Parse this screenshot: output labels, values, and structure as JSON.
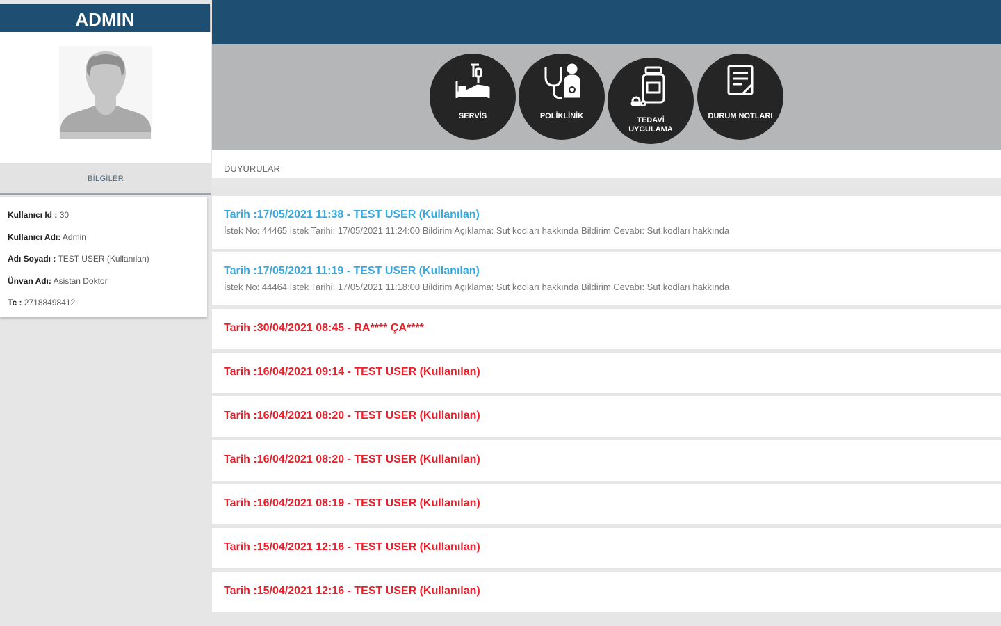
{
  "sidebar": {
    "header_title": "ADMIN",
    "bilgiler_label": "BİLGİLER",
    "info": [
      {
        "label": "Kullanıcı Id :",
        "value": "30"
      },
      {
        "label": "Kullanıcı Adı:",
        "value": "Admin"
      },
      {
        "label": "Adı Soyadı :",
        "value": "TEST USER (Kullanılan)"
      },
      {
        "label": "Ünvan Adı:",
        "value": "Asistan Doktor"
      },
      {
        "label": "Tc :",
        "value": "27188498412"
      }
    ]
  },
  "menu": {
    "buttons": [
      {
        "label": "SERVİS",
        "icon": "hospital-bed-iv-icon"
      },
      {
        "label": "POLİKLİNİK",
        "icon": "stethoscope-doctor-icon"
      },
      {
        "label_line1": "TEDAVİ",
        "label_line2": "UYGULAMA",
        "icon": "medicine-bottle-pills-icon"
      },
      {
        "label": "DURUM NOTLARI",
        "icon": "notes-document-icon"
      }
    ]
  },
  "announcements_header": "DUYURULAR",
  "announcements": [
    {
      "title": "Tarih :17/05/2021  11:38 - TEST USER (Kullanılan)",
      "detail": "İstek No: 44465 İstek Tarihi: 17/05/2021 11:24:00 Bildirim Açıklama: Sut kodları hakkında Bildirim Cevabı: Sut kodları hakkında"
    },
    {
      "title": "Tarih :17/05/2021  11:19 - TEST USER (Kullanılan)",
      "detail": "İstek No: 44464 İstek Tarihi: 17/05/2021 11:18:00 Bildirim Açıklama: Sut kodları hakkında Bildirim Cevabı: Sut kodları hakkında"
    },
    {
      "title": "Tarih :30/04/2021  08:45 - RA**** ÇA****"
    },
    {
      "title": "Tarih :16/04/2021  09:14 - TEST USER (Kullanılan)"
    },
    {
      "title": "Tarih :16/04/2021  08:20 - TEST USER (Kullanılan)"
    },
    {
      "title": "Tarih :16/04/2021  08:20 - TEST USER (Kullanılan)"
    },
    {
      "title": "Tarih :16/04/2021  08:19 - TEST USER (Kullanılan)"
    },
    {
      "title": "Tarih :15/04/2021  12:16 - TEST USER (Kullanılan)"
    },
    {
      "title": "Tarih :15/04/2021  12:16 - TEST USER (Kullanılan)"
    }
  ],
  "colors": {
    "header_blue": "#1f4e73",
    "read_blue": "#35a9e2",
    "unread_red": "#ea1f2a",
    "circle_dark": "#252525",
    "band_gray": "#b5b6b8"
  }
}
